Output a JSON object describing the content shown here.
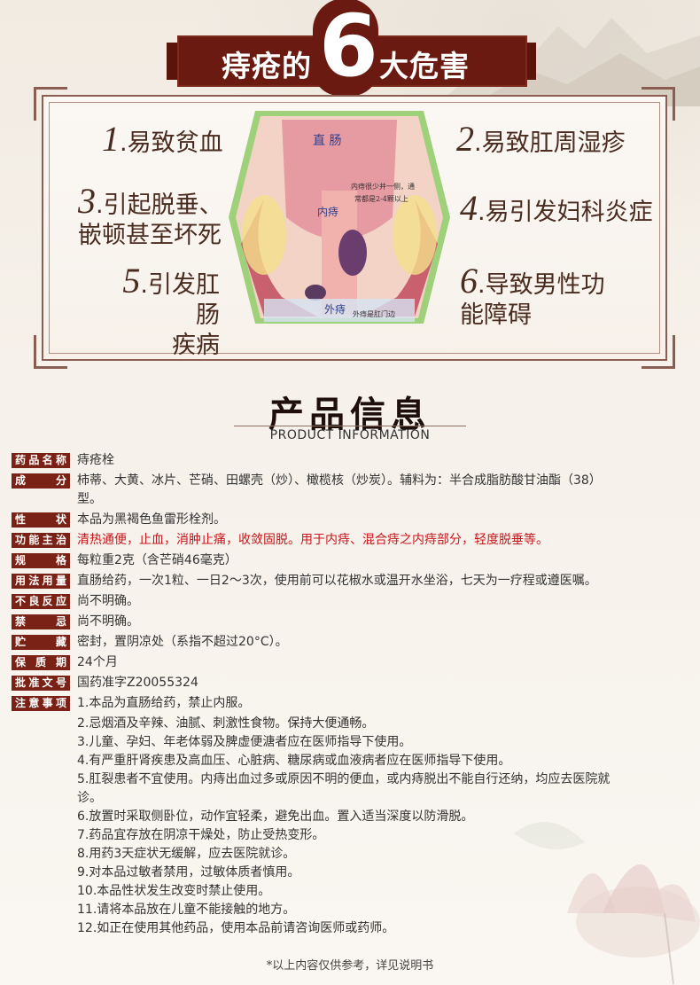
{
  "banner": {
    "part1": "痔疮的",
    "big_number": "6",
    "part2": "大危害"
  },
  "harms": [
    {
      "num": "1",
      "text": "易致贫血"
    },
    {
      "num": "2",
      "text": "易致肛周湿疹"
    },
    {
      "num": "3",
      "text": "引起脱垂、",
      "text2": "嵌顿甚至坏死"
    },
    {
      "num": "4",
      "text": "易引发妇科炎症"
    },
    {
      "num": "5",
      "text": "引发肛肠",
      "text2": "疾病"
    },
    {
      "num": "6",
      "text": "导致男性功",
      "text2": "能障碍"
    }
  ],
  "anatomy": {
    "label_rectum": "直 肠",
    "label_internal": "内痔",
    "label_external": "外痔",
    "note1": "内痔很少并一侧，通",
    "note2": "常都是2-4颗以上",
    "note3": "外痔是肛门边"
  },
  "product_info": {
    "title": "产品信息",
    "subtitle": "PRODUCT INFORMATION"
  },
  "specs": [
    {
      "label": "药品名称",
      "value": "痔疮栓"
    },
    {
      "label": "成分",
      "value": "柿蒂、大黄、冰片、芒硝、田螺壳（炒）、橄榄核（炒炭）。辅料为：半合成脂肪酸甘油酯（38）",
      "value2": "型。"
    },
    {
      "label": "性状",
      "value": "本品为黑褐色鱼雷形栓剂。"
    },
    {
      "label": "功能主治",
      "value": "清热通便，止血，消肿止痛，收敛固脱。用于内痔、混合痔之内痔部分，轻度脱垂等。",
      "red": true
    },
    {
      "label": "规格",
      "value": "每粒重2克（含芒硝46毫克）"
    },
    {
      "label": "用法用量",
      "value": "直肠给药，一次1粒、一日2～3次，使用前可以花椒水或温开水坐浴，七天为一疗程或遵医嘱。"
    },
    {
      "label": "不良反应",
      "value": "尚不明确。"
    },
    {
      "label": "禁忌",
      "value": "尚不明确。"
    },
    {
      "label": "贮藏",
      "value": "密封，置阴凉处（系指不超过20°C）。"
    },
    {
      "label": "保质期",
      "value": "24个月"
    },
    {
      "label": "批准文号",
      "value": "国药准字Z20055324"
    },
    {
      "label": "注意事项",
      "value": "1.本品为直肠给药，禁止内服。"
    }
  ],
  "notes": [
    "2.忌烟酒及辛辣、油腻、刺激性食物。保持大便通畅。",
    "3.儿童、孕妇、年老体弱及脾虚便溏者应在医师指导下使用。",
    "4.有严重肝肾疾患及高血压、心脏病、糖尿病或血液病者应在医师指导下使用。",
    "5.肛裂患者不宜使用。内痔出血过多或原因不明的便血，或内痔脱出不能自行还纳，均应去医院就",
    "诊。",
    "6.放置时采取侧卧位，动作宜轻柔，避免出血。置入适当深度以防滑脱。",
    "7.药品宜存放在阴凉干燥处，防止受热变形。",
    "8.用药3天症状无缓解，应去医院就诊。",
    "9.对本品过敏者禁用，过敏体质者慎用。",
    "10.本品性状发生改变时禁止使用。",
    "11.请将本品放在儿童不能接触的地方。",
    "12.如正在使用其他药品，使用本品前请咨询医师或药师。"
  ],
  "footnote": "*以上内容仅供参考，详见说明书",
  "colors": {
    "banner": "#6a1a10",
    "label_bg": "#7a2216",
    "red_text": "#c8161d"
  }
}
